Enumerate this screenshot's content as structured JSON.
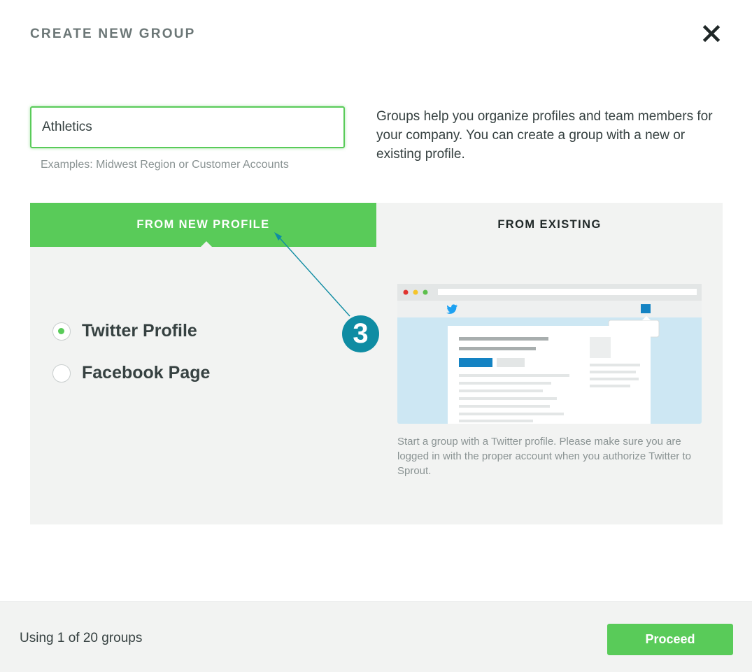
{
  "dialog": {
    "title": "CREATE NEW GROUP",
    "close_icon": "close-icon"
  },
  "form": {
    "group_name_value": "Athletics",
    "hint": "Examples: Midwest Region or Customer Accounts",
    "help_text": "Groups help you organize profiles and team members for your company. You can create a group with a new or existing profile."
  },
  "tabs": [
    {
      "label": "FROM NEW PROFILE",
      "active": true
    },
    {
      "label": "FROM EXISTING",
      "active": false
    }
  ],
  "options": [
    {
      "label": "Twitter Profile",
      "selected": true
    },
    {
      "label": "Facebook Page",
      "selected": false
    }
  ],
  "preview": {
    "caption": "Start a group with a Twitter profile. Please make sure you are logged in with the proper account when you authorize Twitter to Sprout.",
    "icons": [
      "twitter-bird-icon",
      "browser-dots-icon"
    ]
  },
  "annotation": {
    "step": "3"
  },
  "footer": {
    "usage_text": "Using 1 of 20 groups",
    "proceed_label": "Proceed"
  },
  "colors": {
    "accent_green": "#59cb59",
    "panel_gray": "#f2f3f2",
    "annotation_teal": "#0f8ca3",
    "twitter_blue": "#1da1f2"
  }
}
